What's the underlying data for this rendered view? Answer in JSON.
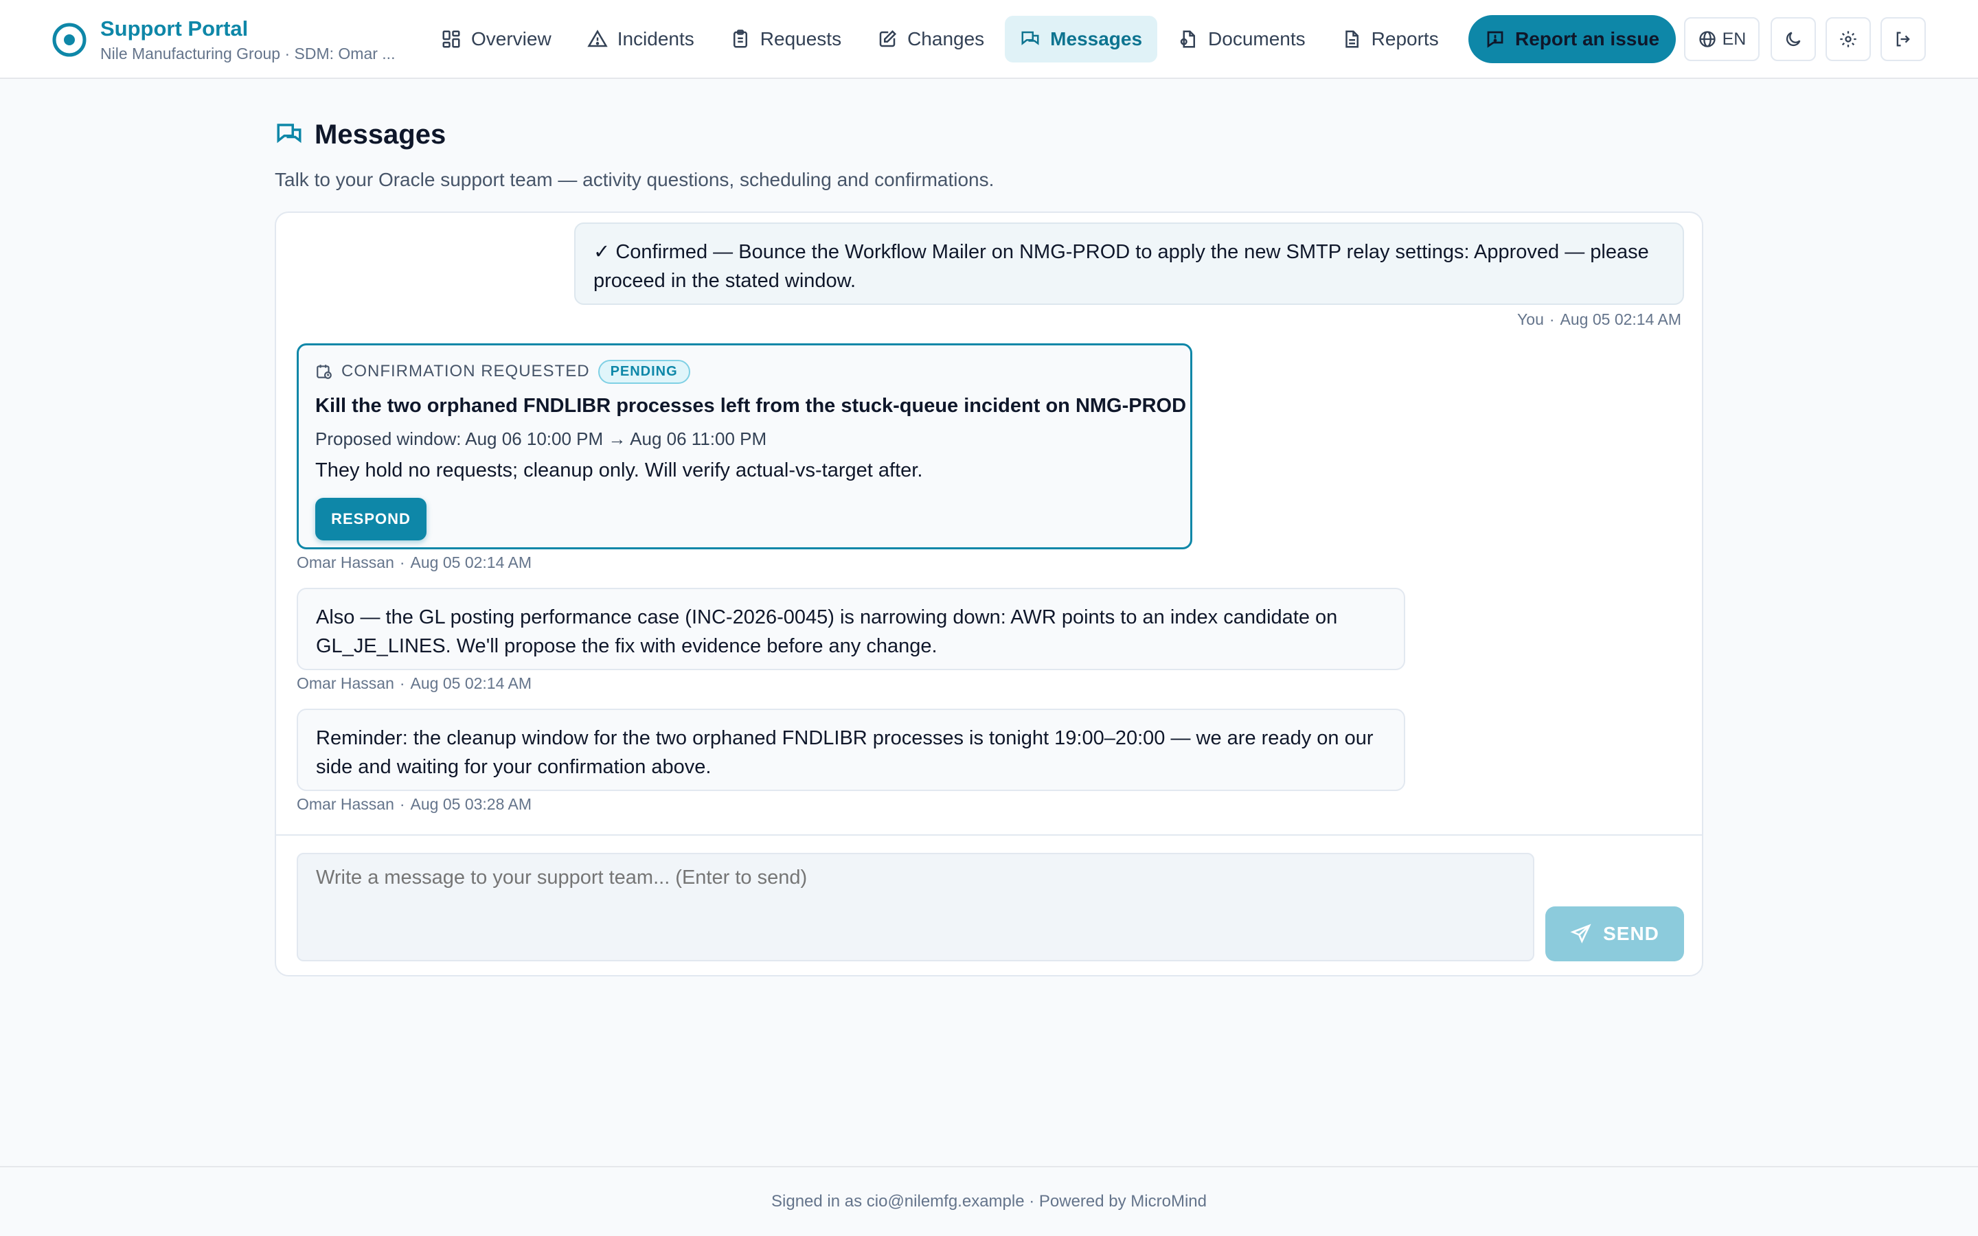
{
  "brand": {
    "title": "Support Portal",
    "subtitle": "Nile Manufacturing Group · SDM: Omar ..."
  },
  "nav": [
    {
      "label": "Overview",
      "icon": "grid-icon"
    },
    {
      "label": "Incidents",
      "icon": "warning-icon"
    },
    {
      "label": "Requests",
      "icon": "clipboard-icon"
    },
    {
      "label": "Changes",
      "icon": "edit-icon"
    },
    {
      "label": "Messages",
      "icon": "chat-icon",
      "active": true
    },
    {
      "label": "Documents",
      "icon": "document-icon"
    },
    {
      "label": "Reports",
      "icon": "report-icon"
    }
  ],
  "header": {
    "report_button": "Report an issue",
    "language": "EN"
  },
  "page": {
    "title": "Messages",
    "subtitle": "Talk to your Oracle support team — activity questions, scheduling and confirmations."
  },
  "messages": {
    "self": {
      "text": "✓ Confirmed — Bounce the Workflow Mailer on NMG-PROD to apply the new SMTP relay settings: Approved — please proceed in the stated window.",
      "author": "You",
      "time": "Aug 05 02:14 AM"
    },
    "confirmation": {
      "kicker": "CONFIRMATION REQUESTED",
      "status": "PENDING",
      "title": "Kill the two orphaned FNDLIBR processes left from the stuck-queue incident on NMG-PROD",
      "window": "Proposed window: Aug 06 10:00 PM → Aug 06 11:00 PM",
      "body": "They hold no requests; cleanup only. Will verify actual-vs-target after.",
      "respond_label": "RESPOND",
      "author": "Omar Hassan",
      "time": "Aug 05 02:14 AM"
    },
    "second": {
      "text": "Also — the GL posting performance case (INC-2026-0045) is narrowing down: AWR points to an index candidate on GL_JE_LINES. We'll propose the fix with evidence before any change.",
      "author": "Omar Hassan",
      "time": "Aug 05 02:14 AM"
    },
    "third": {
      "text": "Reminder: the cleanup window for the two orphaned FNDLIBR processes is tonight 19:00–20:00 — we are ready on our side and waiting for your confirmation above.",
      "author": "Omar Hassan",
      "time": "Aug 05 03:28 AM"
    }
  },
  "composer": {
    "placeholder": "Write a message to your support team... (Enter to send)",
    "send_label": "SEND"
  },
  "footer": {
    "text": "Signed in as cio@nilemfg.example · Powered by MicroMind"
  },
  "colors": {
    "accent": "#0e87a8",
    "accent_soft": "#e0f2f7",
    "send_disabled": "#8ccbdc"
  }
}
